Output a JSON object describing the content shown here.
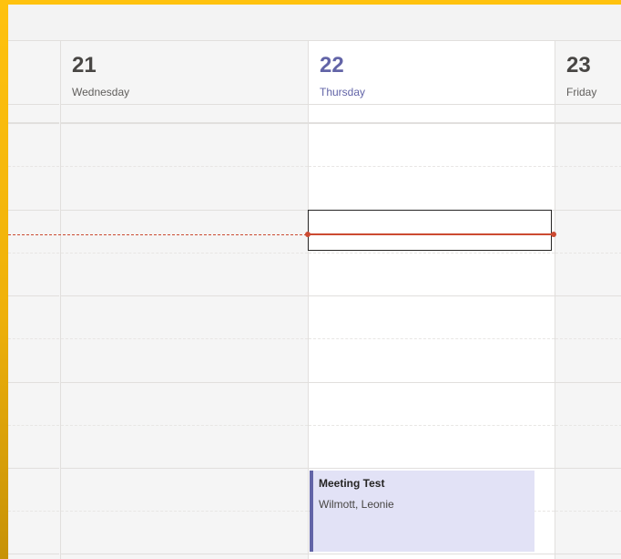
{
  "days": [
    {
      "num": "21",
      "name": "Wednesday"
    },
    {
      "num": "22",
      "name": "Thursday",
      "today": true
    },
    {
      "num": "23",
      "name": "Friday"
    }
  ],
  "event": {
    "title": "Meeting Test",
    "organizer": "Wilmott, Leonie"
  },
  "colors": {
    "accent": "#6264a7",
    "event_bg": "#e2e2f6",
    "current_time": "#cc4a31",
    "frame": "#ffc20e"
  }
}
